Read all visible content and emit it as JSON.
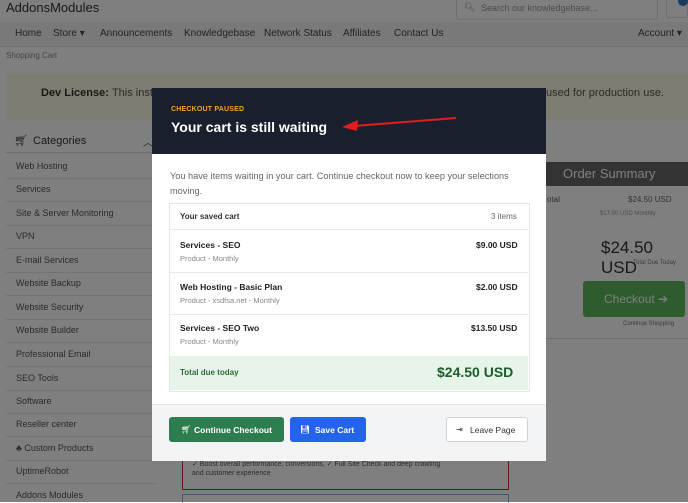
{
  "header": {
    "brand": "AddonsModules",
    "search_placeholder": "Search our knowledgebase...",
    "account_label": "Account"
  },
  "nav": {
    "items": [
      "Home",
      "Store",
      "Announcements",
      "Knowledgebase",
      "Network Status",
      "Affiliates",
      "Contact Us"
    ]
  },
  "breadcrumb": "Shopping Cart",
  "alert": {
    "strong": "Dev License:",
    "text_start": "This instal",
    "text_end": "used for production use."
  },
  "sidebar": {
    "title": "Categories",
    "items": [
      "Web Hosting",
      "Services",
      "Site & Server Monitoring",
      "VPN",
      "E-mail Services",
      "Website Backup",
      "Website Security",
      "Website Builder",
      "Professional Email",
      "SEO Tools",
      "Software",
      "Reseller center",
      "Custom Products",
      "UptimeRobot",
      "Addons Modules"
    ]
  },
  "order_summary": {
    "title": "Order Summary",
    "total_label": "otal",
    "total_value": "$24.50 USD",
    "sub_text": "$17.00 USD Monthly",
    "big_total": "$24.50 USD",
    "due_label": "Total Due Today",
    "checkout_label": "Checkout",
    "continue_label": "Continue Shopping"
  },
  "promo": {
    "line1": "✓ Boost overall performance, conversions,  ✓ Full Site Check and deep crawling",
    "line2": "and customer experience"
  },
  "modal": {
    "eyebrow": "CHECKOUT PAUSED",
    "title": "Your cart is still waiting",
    "description": "You have items waiting in your cart. Continue checkout now to keep your selections moving.",
    "saved_title": "Your saved cart",
    "saved_count": "3 items",
    "items": [
      {
        "name": "Services - SEO",
        "detail": "Product - Monthly",
        "price": "$9.00 USD"
      },
      {
        "name": "Web Hosting - Basic Plan",
        "detail": "Product - xsdfsa.net - Monthly",
        "price": "$2.00 USD"
      },
      {
        "name": "Services - SEO Two",
        "detail": "Product - Monthly",
        "price": "$13.50 USD"
      }
    ],
    "total_label": "Total due today",
    "total_value": "$24.50 USD",
    "buttons": {
      "continue": "Continue Checkout",
      "save": "Save Cart",
      "leave": "Leave Page"
    }
  },
  "colors": {
    "modal_header": "#1a1f2e",
    "eyebrow": "#f5a623",
    "continue_btn": "#2e7d4f",
    "save_btn": "#2563eb",
    "arrow": "#e11d1d",
    "total_bg": "#e6f4ea"
  }
}
